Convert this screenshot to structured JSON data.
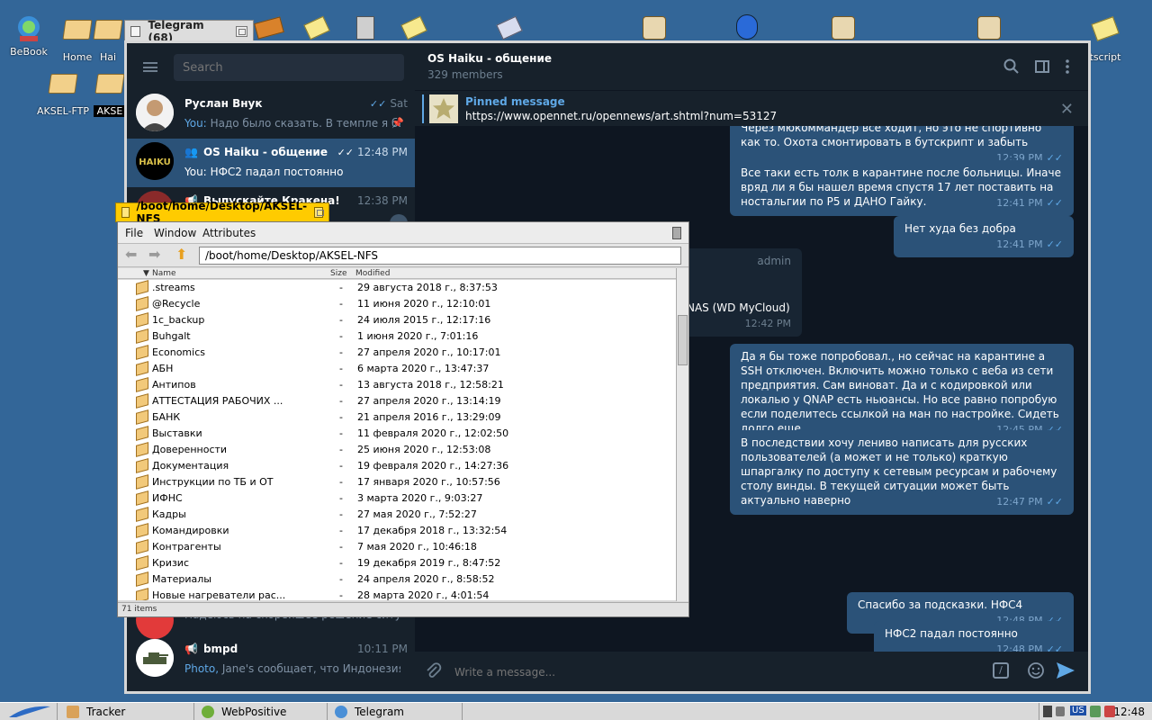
{
  "desktop": {
    "icons": [
      {
        "label": "BeBook"
      },
      {
        "label": "Home"
      },
      {
        "label": "Hai"
      },
      {
        "label": "AKSEL-FTP"
      },
      {
        "label": "AKSE"
      },
      {
        "label": "tscript"
      }
    ]
  },
  "telegram": {
    "window_title": "Telegram (68)",
    "search_placeholder": "Search",
    "chats": [
      {
        "name": "Руслан Внук",
        "time": "Sat",
        "preview_you": "You:",
        "preview": "Надо было сказать. В темпле я бы н..."
      },
      {
        "name": "OS Haiku - общение",
        "time": "12:48 PM",
        "preview_you": "You:",
        "preview": "НФС2 падал постоянно"
      },
      {
        "name": "Выпускайте Кракена!",
        "time": "12:38 PM"
      },
      {
        "name": "",
        "preview": "Надеюсь на скорейшее решение ситуаций..."
      },
      {
        "name": "bmpd",
        "time": "10:11 PM",
        "preview_you": "Photo,",
        "preview": "Jane's сообщает, что Индонезия запла..."
      }
    ],
    "header": {
      "title": "OS Haiku - общение",
      "subtitle": "329 members"
    },
    "pinned": {
      "title": "Pinned message",
      "text": "https://www.opennet.ru/opennews/art.shtml?num=53127"
    },
    "messages": [
      {
        "text": "Через мюкоммандер все ходит, но это не спортивно как то. Охота смонтировать в бутскрипт и забыть",
        "time": "12:39 PM"
      },
      {
        "text": "Все таки есть толк в карантине после больницы. Иначе вряд ли я бы нашел время спустя 17 лет поставить на ностальгии по P5 и ДАНО Гайку.",
        "time": "12:41 PM"
      },
      {
        "text": "Нет худа без добра",
        "time": "12:41 PM"
      },
      {
        "sender": "admin",
        "text": "NAS (WD MyCloud)",
        "time": "12:42 PM"
      },
      {
        "text": "Да я бы тоже попробовал., но сейчас на карантине а SSH отключен. Включить можно только с веба из сети предприятия. Сам виноват. Да и с кодировкой или локалью у QNAP есть ньюансы. Но все равно попробую если поделитесь ссылкой на ман по настройке. Сидеть долго еще",
        "time": "12:45 PM"
      },
      {
        "text": "В последствии хочу лениво написать для русских пользователей (а может и не только) краткую шпаргалку по доступу к сетевым ресурсам и рабочему столу винды. В текущей ситуации может быть актуально наверно",
        "time": "12:47 PM"
      },
      {
        "text": "Спасибо за подсказки. НФС4",
        "time": "12:48 PM"
      },
      {
        "text": "НФС2 падал постоянно",
        "time": "12:48 PM"
      }
    ],
    "composer_placeholder": "Write a message..."
  },
  "tracker": {
    "window_title": "/boot/home/Desktop/AKSEL-NFS",
    "menu": [
      "File",
      "Window",
      "Attributes"
    ],
    "path": "/boot/home/Desktop/AKSEL-NFS",
    "columns": {
      "name": "Name",
      "size": "Size",
      "modified": "Modified"
    },
    "rows": [
      {
        "name": ".streams",
        "size": "-",
        "modified": "29 августа 2018 г., 8:37:53"
      },
      {
        "name": "@Recycle",
        "size": "-",
        "modified": "11 июня 2020 г., 12:10:01"
      },
      {
        "name": "1c_backup",
        "size": "-",
        "modified": "24 июля 2015 г., 12:17:16"
      },
      {
        "name": "Buhgalt",
        "size": "-",
        "modified": "1 июня 2020 г., 7:01:16"
      },
      {
        "name": "Economics",
        "size": "-",
        "modified": "27 апреля 2020 г., 10:17:01"
      },
      {
        "name": "АБН",
        "size": "-",
        "modified": "6 марта 2020 г., 13:47:37"
      },
      {
        "name": "Антипов",
        "size": "-",
        "modified": "13 августа 2018 г., 12:58:21"
      },
      {
        "name": "АТТЕСТАЦИЯ РАБОЧИХ ...",
        "size": "-",
        "modified": "27 апреля 2020 г., 13:14:19"
      },
      {
        "name": "БАНК",
        "size": "-",
        "modified": "21 апреля 2016 г., 13:29:09"
      },
      {
        "name": "Выставки",
        "size": "-",
        "modified": "11 февраля 2020 г., 12:02:50"
      },
      {
        "name": "Доверенности",
        "size": "-",
        "modified": "25 июня 2020 г., 12:53:08"
      },
      {
        "name": "Документация",
        "size": "-",
        "modified": "19 февраля 2020 г., 14:27:36"
      },
      {
        "name": "Инструкции по ТБ и ОТ",
        "size": "-",
        "modified": "17 января 2020 г., 10:57:56"
      },
      {
        "name": "ИФНС",
        "size": "-",
        "modified": "3 марта 2020 г., 9:03:27"
      },
      {
        "name": "Кадры",
        "size": "-",
        "modified": "27 мая 2020 г., 7:52:27"
      },
      {
        "name": "Командировки",
        "size": "-",
        "modified": "17 декабря 2018 г., 13:32:54"
      },
      {
        "name": "Контрагенты",
        "size": "-",
        "modified": "7 мая 2020 г., 10:46:18"
      },
      {
        "name": "Кризис",
        "size": "-",
        "modified": "19 декабря 2019 г., 8:47:52"
      },
      {
        "name": "Материалы",
        "size": "-",
        "modified": "24 апреля 2020 г., 8:58:52"
      },
      {
        "name": "Новые нагреватели рас...",
        "size": "-",
        "modified": "28 марта 2020 г., 4:01:54"
      }
    ],
    "status": "71 items"
  },
  "taskbar": {
    "items": [
      {
        "label": "Tracker"
      },
      {
        "label": "WebPositive"
      },
      {
        "label": "Telegram"
      }
    ],
    "lang": "US",
    "clock": "12:48"
  }
}
